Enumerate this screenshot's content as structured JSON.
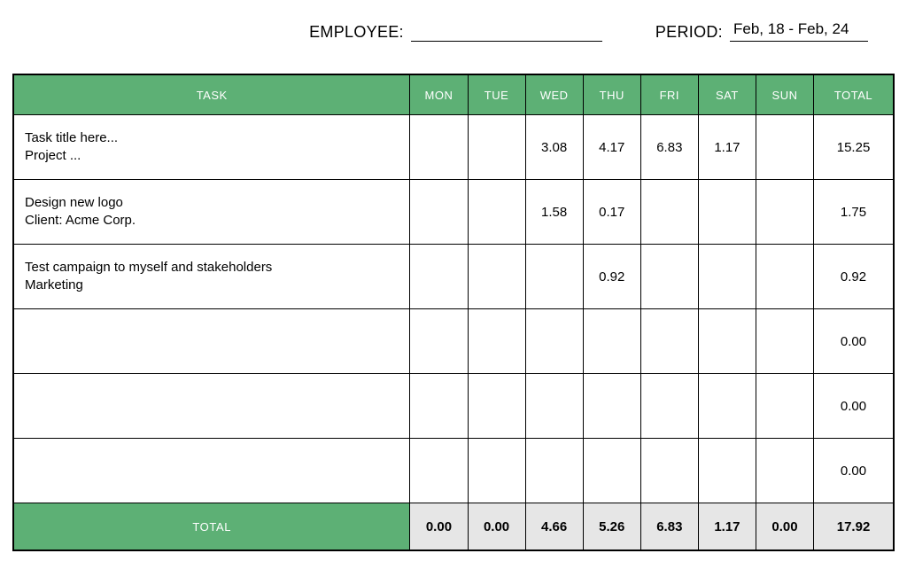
{
  "header": {
    "employee_label": "EMPLOYEE:",
    "employee_value": "",
    "period_label": "PERIOD:",
    "period_value": "Feb, 18 - Feb, 24"
  },
  "columns": {
    "task": "TASK",
    "mon": "MON",
    "tue": "TUE",
    "wed": "WED",
    "thu": "THU",
    "fri": "FRI",
    "sat": "SAT",
    "sun": "SUN",
    "total": "TOTAL"
  },
  "rows": [
    {
      "title": "Task title here...",
      "sub": "Project ...",
      "mon": "",
      "tue": "",
      "wed": "3.08",
      "thu": "4.17",
      "fri": "6.83",
      "sat": "1.17",
      "sun": "",
      "total": "15.25"
    },
    {
      "title": "Design new logo",
      "sub": "Client: Acme Corp.",
      "mon": "",
      "tue": "",
      "wed": "1.58",
      "thu": "0.17",
      "fri": "",
      "sat": "",
      "sun": "",
      "total": "1.75"
    },
    {
      "title": "Test campaign to myself and stakeholders",
      "sub": "Marketing",
      "mon": "",
      "tue": "",
      "wed": "",
      "thu": "0.92",
      "fri": "",
      "sat": "",
      "sun": "",
      "total": "0.92"
    },
    {
      "title": "",
      "sub": "",
      "mon": "",
      "tue": "",
      "wed": "",
      "thu": "",
      "fri": "",
      "sat": "",
      "sun": "",
      "total": "0.00"
    },
    {
      "title": "",
      "sub": "",
      "mon": "",
      "tue": "",
      "wed": "",
      "thu": "",
      "fri": "",
      "sat": "",
      "sun": "",
      "total": "0.00"
    },
    {
      "title": "",
      "sub": "",
      "mon": "",
      "tue": "",
      "wed": "",
      "thu": "",
      "fri": "",
      "sat": "",
      "sun": "",
      "total": "0.00"
    }
  ],
  "footer": {
    "label": "TOTAL",
    "mon": "0.00",
    "tue": "0.00",
    "wed": "4.66",
    "thu": "5.26",
    "fri": "6.83",
    "sat": "1.17",
    "sun": "0.00",
    "total": "17.92"
  }
}
